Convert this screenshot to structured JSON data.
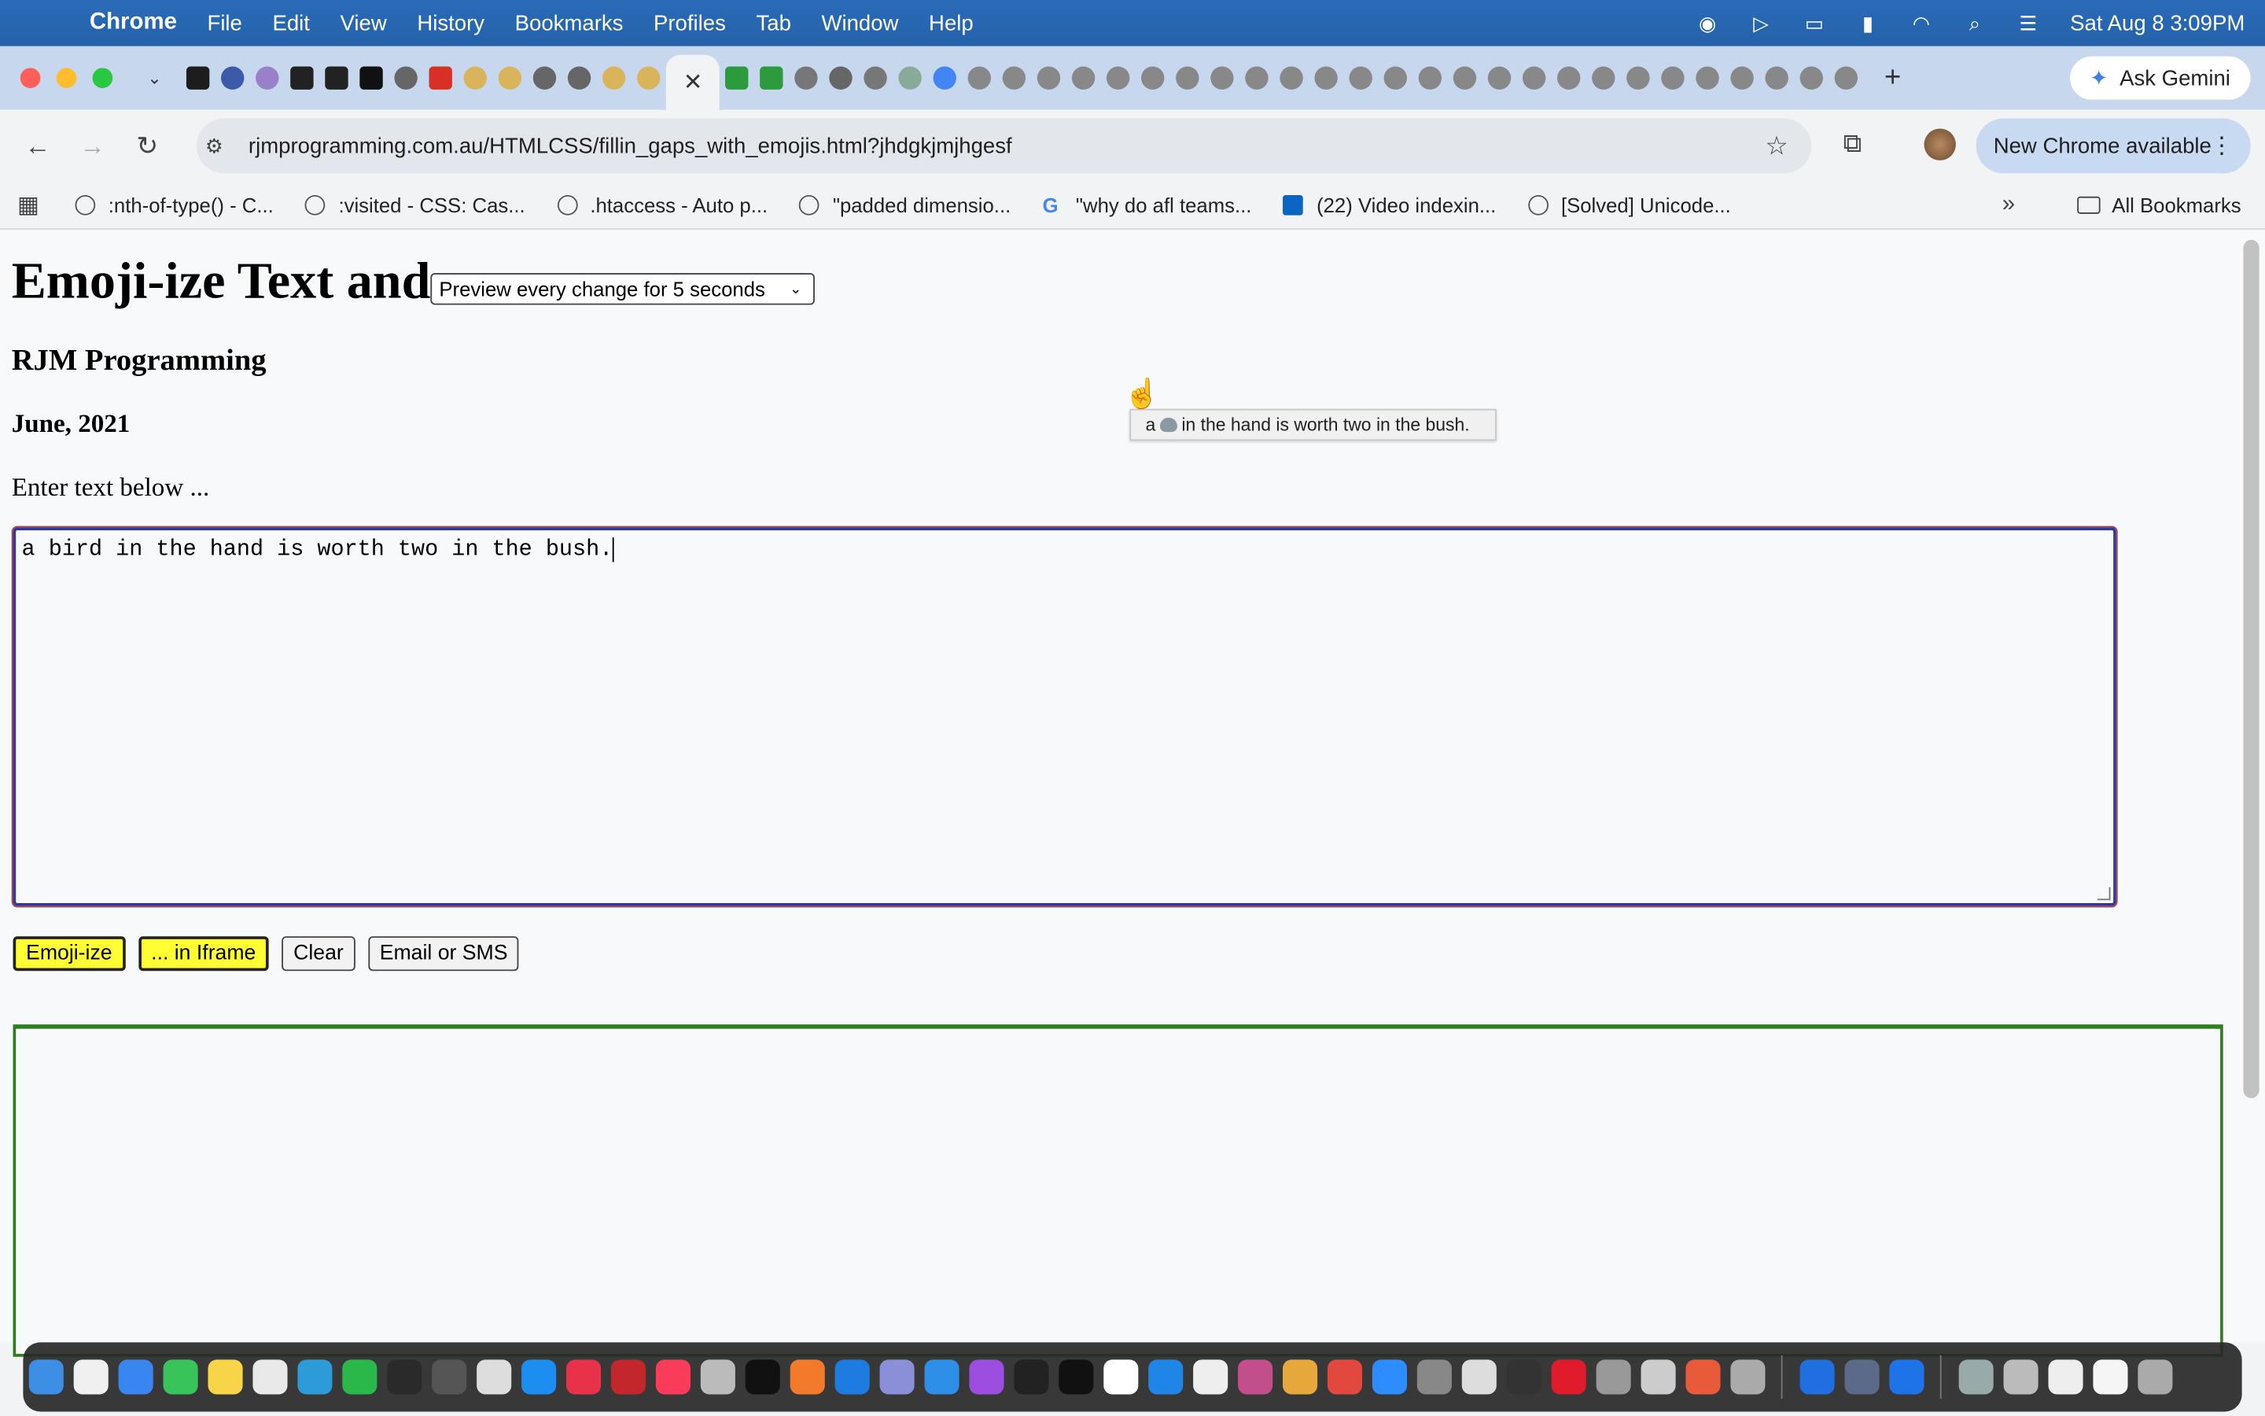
{
  "menubar": {
    "app_name": "Chrome",
    "items": [
      "File",
      "Edit",
      "View",
      "History",
      "Bookmarks",
      "Profiles",
      "Tab",
      "Window",
      "Help"
    ],
    "clock": "Sat Aug 8  3:09PM"
  },
  "tabs": {
    "active_close": "✕",
    "gemini_label": "Ask Gemini",
    "new_tab": "+"
  },
  "toolbar": {
    "url": "rjmprogramming.com.au/HTMLCSS/fillin_gaps_with_emojis.html?jhdgkjmjhgesf",
    "update_label": "New Chrome available"
  },
  "bookmarks": {
    "items": [
      ":nth-of-type() - C...",
      ":visited - CSS: Cas...",
      ".htaccess - Auto p...",
      "\"padded dimensio...",
      "\"why do afl teams...",
      "(22) Video indexin...",
      "[Solved] Unicode..."
    ],
    "all_label": "All Bookmarks"
  },
  "page": {
    "title": "Emoji-ize Text and",
    "preview_option": "Preview every change for 5 seconds",
    "subtitle": "RJM Programming",
    "date": "June, 2021",
    "prompt": "Enter text below ...",
    "textarea_value": "a bird in the hand is worth two in the bush.",
    "buttons": {
      "emojiize": "Emoji-ize",
      "in_iframe": "... in Iframe",
      "clear": "Clear",
      "email_sms": "Email or SMS"
    },
    "tooltip_before": "a",
    "tooltip_after": "in the hand is worth two in the bush."
  },
  "colors": {
    "menubar": "#2461aa",
    "tabstrip": "#c7d7ee",
    "yellow_button": "#ffff33",
    "textarea_border": "#2c3a9e",
    "iframe_border": "#2e7d1e"
  }
}
